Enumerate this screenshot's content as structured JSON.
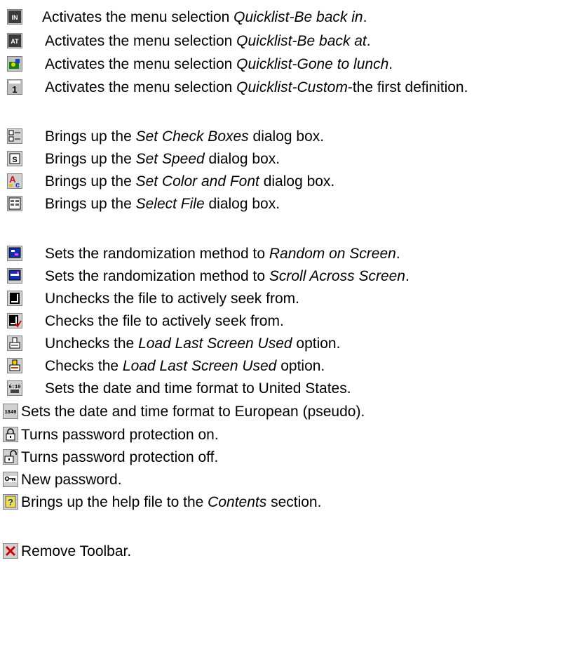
{
  "items": [
    {
      "icon": "in-icon",
      "pre": "Activates the menu selection ",
      "em": "Quicklist-Be back in",
      "post": "."
    },
    {
      "icon": "at-icon",
      "pre": "Activates the menu selection ",
      "em": "Quicklist-Be back at",
      "post": "."
    },
    {
      "icon": "lunch-icon",
      "pre": "Activates the menu selection ",
      "em": "Quicklist-Gone to lunch",
      "post": "."
    },
    {
      "icon": "custom-one-icon",
      "pre": "Activates the menu selection ",
      "em": "Quicklist-Custom",
      "post": "-the first definition."
    },
    {
      "icon": "check-boxes-icon",
      "pre": "Brings up the ",
      "em": "Set Check Boxes",
      "post": " dialog box."
    },
    {
      "icon": "speed-icon",
      "pre": "Brings up the ",
      "em": "Set Speed",
      "post": " dialog box."
    },
    {
      "icon": "color-font-icon",
      "pre": "Brings up the ",
      "em": "Set Color and Font",
      "post": " dialog box."
    },
    {
      "icon": "select-file-icon",
      "pre": "Brings up the ",
      "em": "Select File",
      "post": " dialog box."
    },
    {
      "icon": "random-screen-icon",
      "pre": "Sets the randomization method to ",
      "em": "Random on Screen",
      "post": "."
    },
    {
      "icon": "scroll-screen-icon",
      "pre": "Sets the randomization method to ",
      "em": "Scroll Across Screen",
      "post": "."
    },
    {
      "icon": "uncheck-file-icon",
      "pre": "Unchecks the file to actively seek from.",
      "em": "",
      "post": ""
    },
    {
      "icon": "check-file-icon",
      "pre": "Checks the file to actively seek from.",
      "em": "",
      "post": ""
    },
    {
      "icon": "uncheck-load-last-icon",
      "pre": "Unchecks the ",
      "em": "Load Last Screen Used",
      "post": " option."
    },
    {
      "icon": "check-load-last-icon",
      "pre": "Checks the ",
      "em": "Load Last Screen Used",
      "post": " option."
    },
    {
      "icon": "us-date-icon",
      "pre": "Sets the date and time format to United States.",
      "em": "",
      "post": ""
    },
    {
      "icon": "european-date-icon",
      "pre": "Sets the date and time format to European (pseudo).",
      "em": "",
      "post": ""
    },
    {
      "icon": "lock-closed-icon",
      "pre": "Turns password protection on.",
      "em": "",
      "post": ""
    },
    {
      "icon": "lock-open-icon",
      "pre": "Turns password protection off.",
      "em": "",
      "post": ""
    },
    {
      "icon": "key-icon",
      "pre": "New password.",
      "em": "",
      "post": ""
    },
    {
      "icon": "help-icon",
      "pre": "Brings up the help file to the ",
      "em": "Contents",
      "post": " section."
    },
    {
      "icon": "close-icon",
      "pre": "Remove Toolbar.",
      "em": "",
      "post": ""
    }
  ],
  "icon_labels": {
    "in": "IN",
    "at": "AT",
    "custom_num": "1",
    "eu_date": "1840"
  }
}
